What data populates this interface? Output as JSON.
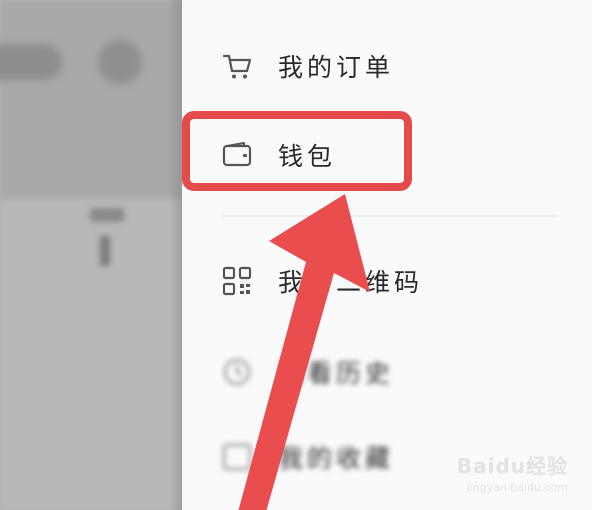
{
  "menu": {
    "orders_label": "我的订单",
    "wallet_label": "钱包",
    "qr_label": "我的二维码",
    "history_label": "观看历史",
    "favorites_label": "我的收藏"
  },
  "annotation": {
    "highlight_color": "#e44b4b",
    "arrow_color": "#ea4d4d"
  },
  "watermark": {
    "brand": "Baidu经验",
    "url": "jingyan.baidu.com"
  },
  "icons": {
    "orders": "shopping-cart-icon",
    "wallet": "wallet-icon",
    "qr": "qr-code-icon"
  }
}
